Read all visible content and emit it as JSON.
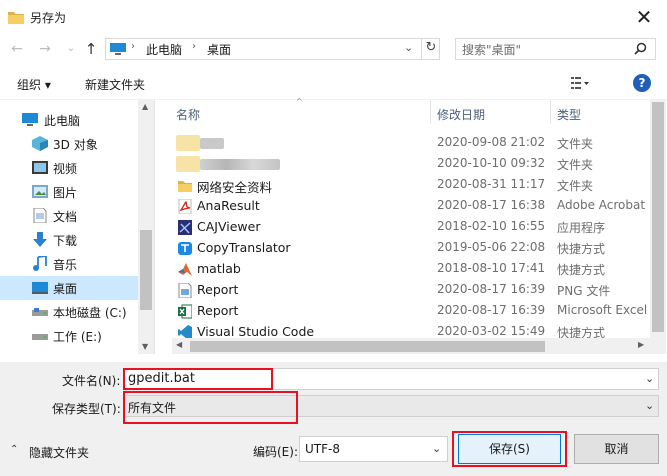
{
  "window": {
    "title": "另存为",
    "close_glyph": "✕"
  },
  "nav": {
    "breadcrumb": [
      "此电脑",
      "桌面"
    ],
    "search_placeholder": "搜索\"桌面\""
  },
  "toolbar": {
    "organize": "组织 ▾",
    "new_folder": "新建文件夹"
  },
  "sidebar": {
    "items": [
      {
        "label": "此电脑",
        "icon": "monitor-icon",
        "indent": 0
      },
      {
        "label": "3D 对象",
        "icon": "cube-3d-icon",
        "indent": 1
      },
      {
        "label": "视频",
        "icon": "video-icon",
        "indent": 1
      },
      {
        "label": "图片",
        "icon": "picture-icon",
        "indent": 1
      },
      {
        "label": "文档",
        "icon": "document-icon",
        "indent": 1
      },
      {
        "label": "下载",
        "icon": "download-icon",
        "indent": 1
      },
      {
        "label": "音乐",
        "icon": "music-icon",
        "indent": 1
      },
      {
        "label": "桌面",
        "icon": "desktop-icon",
        "indent": 1
      },
      {
        "label": "本地磁盘 (C:)",
        "icon": "drive-icon",
        "indent": 1
      },
      {
        "label": "工作 (E:)",
        "icon": "drive-icon",
        "indent": 1
      }
    ]
  },
  "columns": {
    "name": "名称",
    "date": "修改日期",
    "type": "类型"
  },
  "files": [
    {
      "name": "",
      "date": "2020-09-08 21:02",
      "type": "文件夹",
      "icon": "blurred-folder-icon"
    },
    {
      "name": "",
      "date": "2020-10-10 09:32",
      "type": "文件夹",
      "icon": "blurred-folder-icon"
    },
    {
      "name": "网络安全资料",
      "date": "2020-08-31 11:17",
      "type": "文件夹",
      "icon": "folder-icon"
    },
    {
      "name": "AnaResult",
      "date": "2020-08-17 16:38",
      "type": "Adobe Acrobat",
      "icon": "pdf-icon"
    },
    {
      "name": "CAJViewer",
      "date": "2018-02-10 16:55",
      "type": "应用程序",
      "icon": "app-icon"
    },
    {
      "name": "CopyTranslator",
      "date": "2019-05-06 22:08",
      "type": "快捷方式",
      "icon": "translator-icon"
    },
    {
      "name": "matlab",
      "date": "2018-08-10 17:41",
      "type": "快捷方式",
      "icon": "matlab-icon"
    },
    {
      "name": "Report",
      "date": "2020-08-17 16:39",
      "type": "PNG 文件",
      "icon": "image-file-icon"
    },
    {
      "name": "Report",
      "date": "2020-08-17 16:39",
      "type": "Microsoft Excel",
      "icon": "excel-icon"
    },
    {
      "name": "Visual Studio Code",
      "date": "2020-03-02 15:49",
      "type": "快捷方式",
      "icon": "vscode-icon"
    }
  ],
  "form": {
    "filename_label": "文件名(N):",
    "filename_value": "gpedit.bat",
    "filetype_label": "保存类型(T):",
    "filetype_value": "所有文件",
    "encoding_label": "编码(E):",
    "encoding_value": "UTF-8"
  },
  "buttons": {
    "hide_folders": "隐藏文件夹",
    "save": "保存(S)",
    "cancel": "取消"
  },
  "colors": {
    "highlight": "#e81123",
    "accent": "#1f5fb8",
    "selected_bg": "#cce8ff"
  }
}
